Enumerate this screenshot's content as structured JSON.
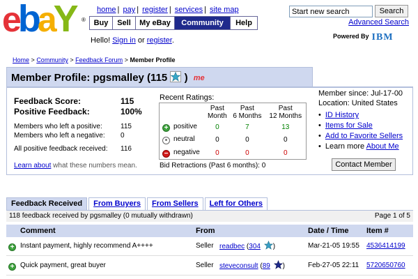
{
  "logo": {
    "e": "e",
    "b": "b",
    "a": "a",
    "y": "Y",
    "reg": "®"
  },
  "toplinks": [
    "home",
    "pay",
    "register",
    "services",
    "site map"
  ],
  "nav": {
    "tabs": [
      "Buy",
      "Sell",
      "My eBay",
      "Community",
      "Help"
    ],
    "active": "Community"
  },
  "hello": {
    "prefix": "Hello!",
    "sign_in": "Sign in",
    "or": "or",
    "register": "register",
    "suffix": "."
  },
  "search": {
    "value": "Start new search",
    "button": "Search",
    "advanced": "Advanced Search"
  },
  "powered_by": {
    "label": "Powered By",
    "brand": "IBM"
  },
  "breadcrumb": {
    "items": [
      "Home",
      "Community",
      "Feedback Forum"
    ],
    "current": "Member Profile",
    "sep": ">"
  },
  "profile": {
    "title_prefix": "Member Profile: pgsmalley (115",
    "title_suffix": ")",
    "me_badge": "me",
    "feedback_score_label": "Feedback Score:",
    "feedback_score": "115",
    "positive_label": "Positive Feedback:",
    "positive_value": "100%",
    "members_positive_label": "Members who left a positive:",
    "members_positive": "115",
    "members_negative_label": "Members who left a negative:",
    "members_negative": "0",
    "all_positive_label": "All positive feedback received:",
    "all_positive": "116",
    "learn_link": "Learn about",
    "learn_rest": "what these numbers mean."
  },
  "ratings": {
    "label": "Recent Ratings:",
    "columns": [
      [
        "Past",
        "Month"
      ],
      [
        "Past",
        "6 Months"
      ],
      [
        "Past",
        "12 Months"
      ]
    ],
    "rows": [
      {
        "label": "positive",
        "kind": "pos",
        "values": [
          "0",
          "7",
          "13"
        ]
      },
      {
        "label": "neutral",
        "kind": "neu",
        "values": [
          "0",
          "0",
          "0"
        ]
      },
      {
        "label": "negative",
        "kind": "neg",
        "values": [
          "0",
          "0",
          "0"
        ]
      }
    ],
    "retractions": "Bid Retractions (Past 6 months): 0"
  },
  "member": {
    "since": "Member since: Jul-17-00",
    "location": "Location: United States",
    "links": [
      "ID History",
      "Items for Sale",
      "Add to Favorite Sellers"
    ],
    "learn_more_prefix": "Learn more",
    "learn_more_link": "About Me",
    "contact_button": "Contact Member"
  },
  "feedback": {
    "tabs": [
      "Feedback Received",
      "From Buyers",
      "From Sellers",
      "Left for Others"
    ],
    "active_tab": "Feedback Received",
    "summary": "118 feedback received by pgsmalley (0 mutually withdrawn)",
    "page": "Page 1 of 5",
    "columns": {
      "comment": "Comment",
      "from": "From",
      "date": "Date / Time",
      "item": "Item #"
    },
    "rows": [
      {
        "comment": "Instant payment, highly recommend A++++",
        "role": "Seller",
        "user": "readbec",
        "score": "304",
        "star_color": "#3399cc",
        "date": "Mar-21-05 19:55",
        "item": "4536414199"
      },
      {
        "comment": "Quick payment, great buyer",
        "role": "Seller",
        "user": "steveconsult",
        "score": "89",
        "star_color": "#1f2a8c",
        "date": "Feb-27-05 22:11",
        "item": "5720650760"
      }
    ]
  },
  "colors": {
    "accent_blue": "#1f2a8c",
    "header_bg": "#cfd8ef",
    "link": "#0000cc",
    "positive": "#008000",
    "negative": "#cc0000"
  }
}
